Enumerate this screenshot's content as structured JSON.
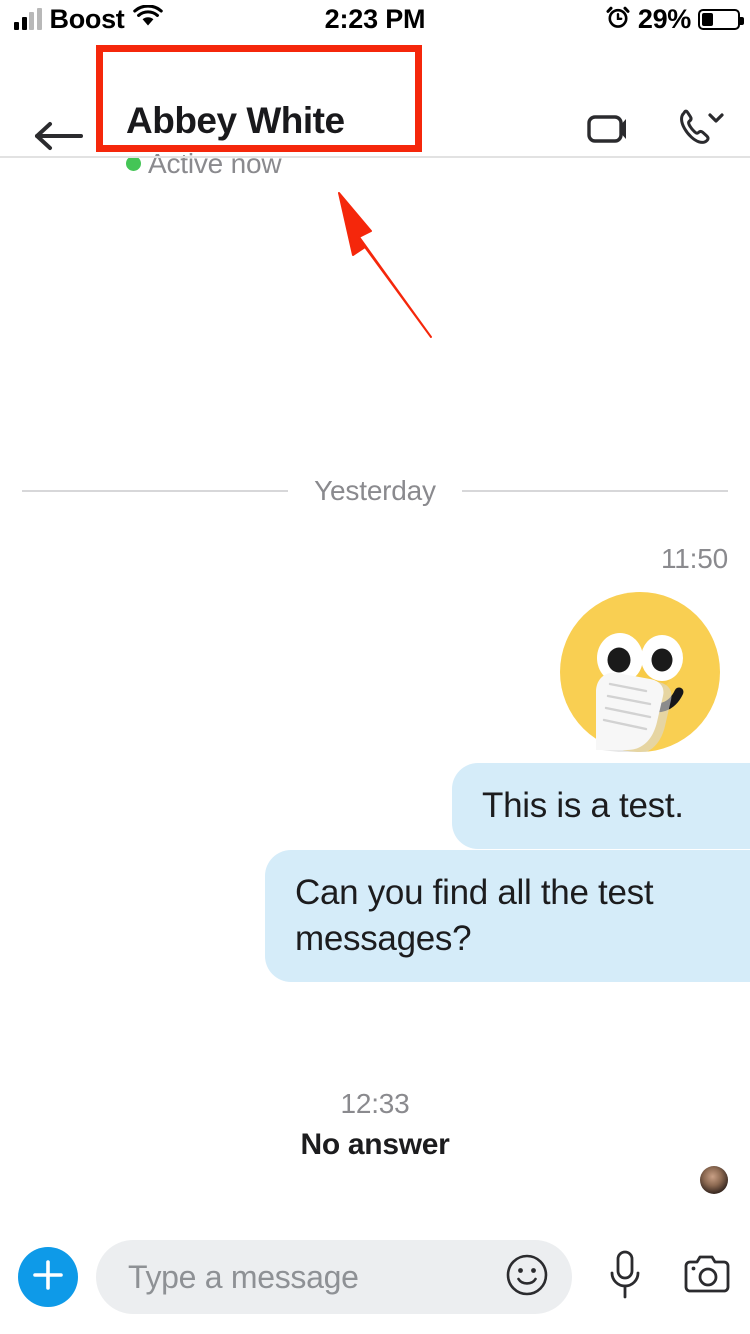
{
  "status_bar": {
    "carrier": "Boost",
    "wifi_icon": "wifi-icon",
    "signal_icon": "signal-bars-icon",
    "time": "2:23 PM",
    "alarm_icon": "alarm-clock-icon",
    "battery_percent": "29%",
    "battery_level": 29
  },
  "header": {
    "back_icon": "back-arrow-icon",
    "contact_name": "Abbey White",
    "presence": "Active now",
    "presence_color": "#44c556",
    "video_call_icon": "video-camera-icon",
    "voice_call_icon": "phone-chevron-icon"
  },
  "annotations": {
    "highlight_color": "#f5270b",
    "box_target": "header-title-block",
    "arrow_target": "header-title-block"
  },
  "conversation": {
    "day_divider": "Yesterday",
    "items": [
      {
        "type": "timestamp",
        "text": "11:50"
      },
      {
        "type": "sticker",
        "name": "face-with-hand-over-mouth-emoji",
        "glyph": "🤭"
      },
      {
        "type": "message",
        "text": "This is a test.",
        "side": "outgoing"
      },
      {
        "type": "message",
        "text": "Can you find all the test messages?",
        "side": "outgoing"
      },
      {
        "type": "read_receipt",
        "name": "contact-avatar"
      },
      {
        "type": "call",
        "time": "12:33",
        "label": "No answer"
      }
    ],
    "bubble_color": "#d5ecf9",
    "bubble_text_color": "#1c1c1e"
  },
  "composer": {
    "add_icon": "plus-icon",
    "add_button_color": "#0e9ae8",
    "input_placeholder": "Type a message",
    "input_value": "",
    "emoji_icon": "smiley-face-icon",
    "mic_icon": "microphone-icon",
    "camera_icon": "camera-icon"
  }
}
